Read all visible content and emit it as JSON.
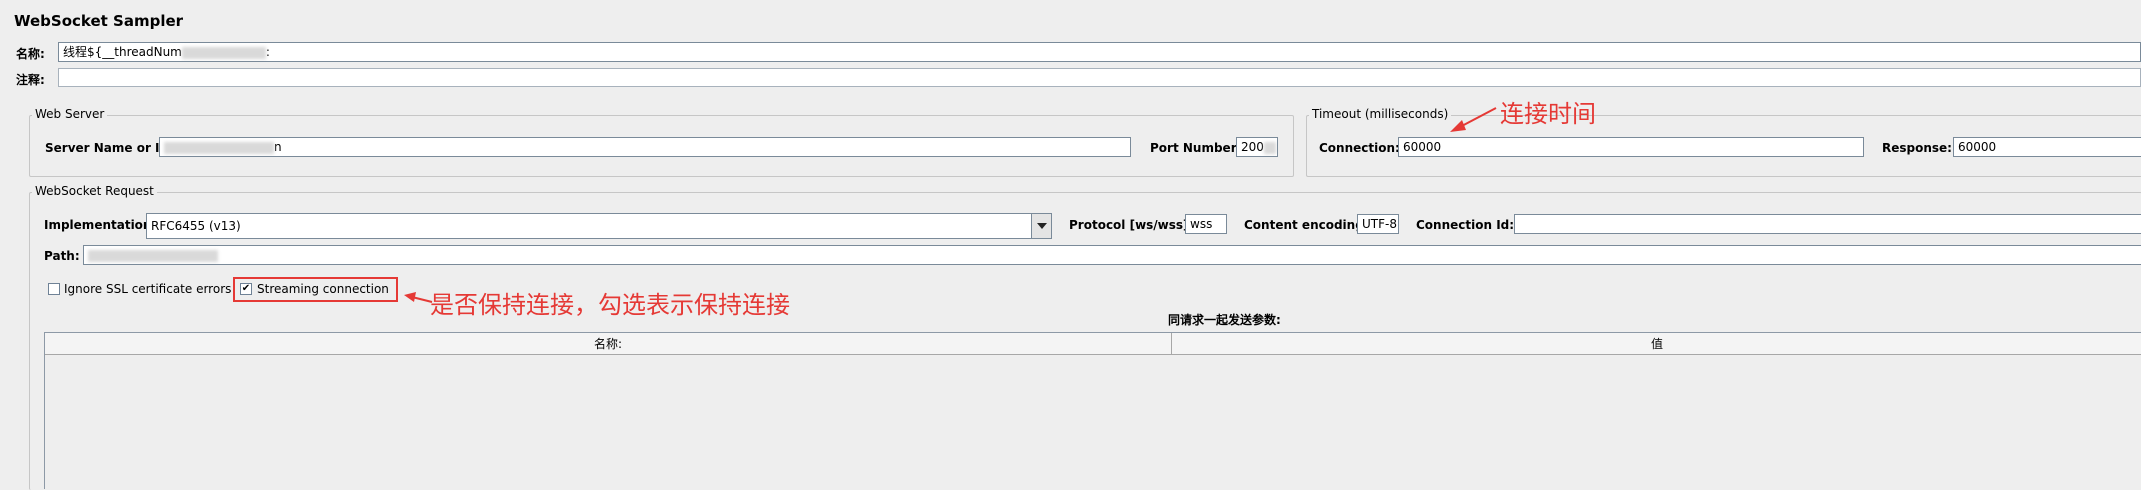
{
  "title": "WebSocket Sampler",
  "name": {
    "label": "名称:",
    "value": "线程${__threadNum",
    "value_tail": ":"
  },
  "comment": {
    "label": "注释:",
    "value": ""
  },
  "web_server": {
    "legend": "Web Server",
    "server_label": "Server Name or IP:",
    "server_value_tail": "n",
    "port_label": "Port Number:",
    "port_value": "200"
  },
  "timeout": {
    "legend": "Timeout (milliseconds)",
    "connection_label": "Connection:",
    "connection_value": "60000",
    "response_label": "Response:",
    "response_value": "60000"
  },
  "request": {
    "legend": "WebSocket Request",
    "implementation_label": "Implementation:",
    "implementation_value": "RFC6455 (v13)",
    "protocol_label": "Protocol [ws/wss]:",
    "protocol_value": "wss",
    "encoding_label": "Content encoding:",
    "encoding_value": "UTF-8",
    "connection_id_label": "Connection Id:",
    "connection_id_value": "",
    "path_label": "Path:",
    "path_value": "",
    "ignore_ssl_label": "Ignore SSL certificate errors",
    "ignore_ssl_checked": false,
    "streaming_label": "Streaming connection",
    "streaming_checked": true,
    "params_title": "同请求一起发送参数:",
    "columns": [
      "名称:",
      "值"
    ]
  },
  "annotations": {
    "timeout_note": "连接时间",
    "streaming_note": "是否保持连接，勾选表示保持连接"
  },
  "colors": {
    "annotation": "#e53935",
    "background": "#eeeeee"
  }
}
